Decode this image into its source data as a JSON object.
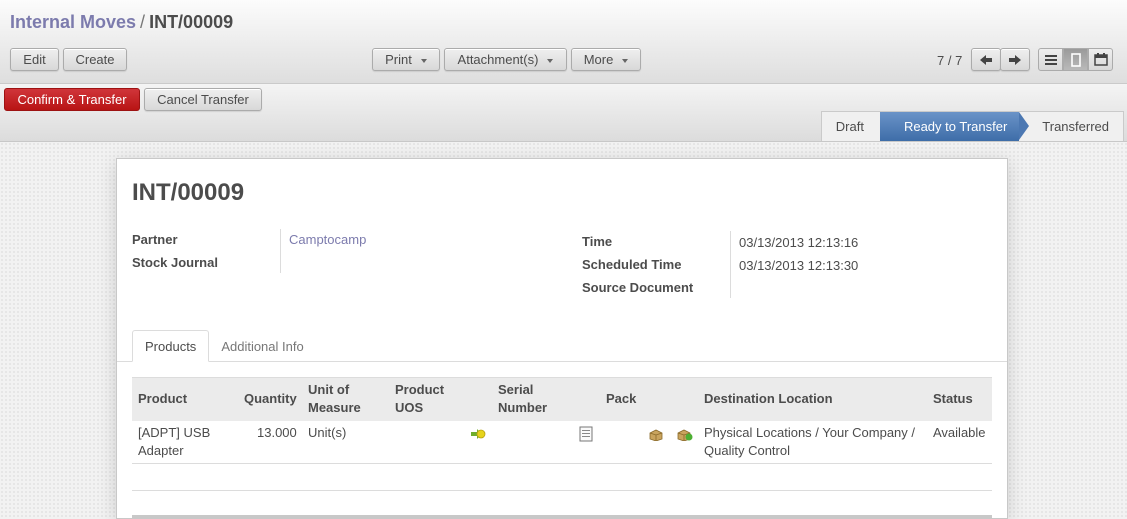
{
  "breadcrumb": {
    "parent": "Internal Moves",
    "separator": "/",
    "current": "INT/00009"
  },
  "toolbar": {
    "edit_label": "Edit",
    "create_label": "Create",
    "print_label": "Print",
    "attachments_label": "Attachment(s)",
    "more_label": "More",
    "pager": "7 / 7"
  },
  "actions": {
    "confirm_label": "Confirm & Transfer",
    "cancel_label": "Cancel Transfer"
  },
  "statusbar": {
    "states": [
      "Draft",
      "Ready to Transfer",
      "Transferred"
    ],
    "active_state": "Ready to Transfer",
    "active_color": "#4c78b2"
  },
  "record": {
    "title": "INT/00009",
    "partner_label": "Partner",
    "partner_value": "Camptocamp",
    "journal_label": "Stock Journal",
    "time_label": "Time",
    "time_value": "03/13/2013 12:13:16",
    "scheduled_label": "Scheduled Time",
    "scheduled_value": "03/13/2013 12:13:30",
    "source_label": "Source Document"
  },
  "tabs": [
    "Products",
    "Additional Info"
  ],
  "products_table": {
    "headers": {
      "product": "Product",
      "quantity": "Quantity",
      "uom_1": "Unit of",
      "uom_2": "Measure",
      "uos_1": "Product",
      "uos_2": "UOS",
      "serial_1": "Serial",
      "serial_2": "Number",
      "pack": "Pack",
      "destination": "Destination Location",
      "status": "Status"
    },
    "rows": [
      {
        "product_1": "[ADPT] USB",
        "product_2": "Adapter",
        "quantity": "13.000",
        "uom": "Unit(s)",
        "destination_1": "Physical Locations / Your Company /",
        "destination_2": "Quality Control",
        "status": "Available"
      }
    ]
  },
  "icons": {
    "prev": "arrow-left-icon",
    "next": "arrow-right-icon",
    "list_view": "list-view-icon",
    "form_view": "form-view-icon",
    "calendar_view": "calendar-view-icon",
    "split_lot": "split-icon",
    "serial_doc": "document-icon",
    "pack_box_1": "package-icon",
    "pack_box_2": "package-add-icon"
  },
  "colors": {
    "link": "#7c7bad",
    "primary_button": "#c0262b"
  }
}
